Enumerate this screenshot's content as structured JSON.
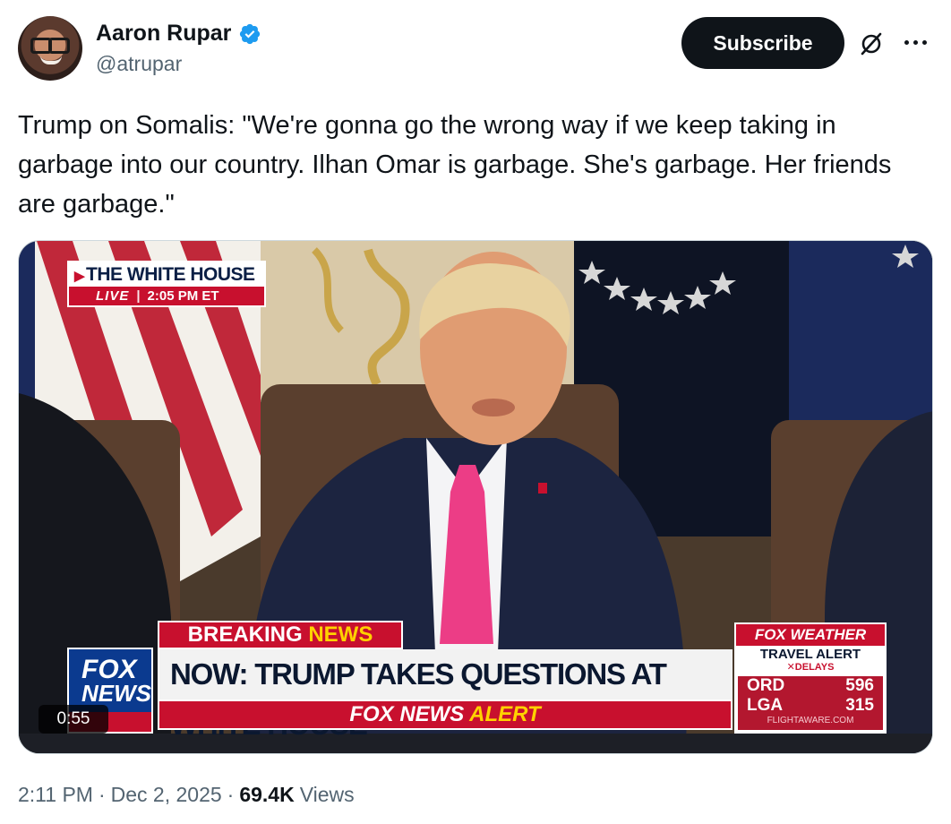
{
  "author": {
    "name": "Aaron Rupar",
    "handle": "@atrupar",
    "verified_icon": "verified-badge-icon",
    "verified_color": "#1d9bf0"
  },
  "actions": {
    "subscribe_label": "Subscribe",
    "grok_icon": "grok-icon",
    "more_icon": "more-options-icon"
  },
  "tweet": {
    "text": "Trump on Somalis: \"We're gonna go the wrong way if we keep taking in garbage into our country. Ilhan Omar is garbage. She's garbage. Her friends are garbage.\""
  },
  "video": {
    "duration": "0:55",
    "location_bug": {
      "title": "THE WHITE HOUSE",
      "live": "LIVE",
      "time": "2:05 PM ET"
    },
    "lower_third": {
      "breaking": "BREAKING",
      "news": "NEWS",
      "headline": "NOW: TRUMP TAKES QUESTIONS AT WHITE HOUSE",
      "alert_fox": "FOX NEWS",
      "alert_word": "ALERT"
    },
    "network_logo": {
      "line1": "FOX",
      "line2": "NEWS"
    },
    "weather": {
      "brand": "FOX WEATHER",
      "title": "TRAVEL ALERT",
      "subtitle": "DELAYS",
      "rows": [
        {
          "airport": "ORD",
          "value": "596"
        },
        {
          "airport": "LGA",
          "value": "315"
        }
      ],
      "source": "FLIGHTAWARE.COM"
    }
  },
  "meta": {
    "time": "2:11 PM",
    "date": "Dec 2, 2025",
    "views_count": "69.4K",
    "views_label": "Views"
  },
  "colors": {
    "text_primary": "#0f1419",
    "text_secondary": "#536471",
    "fox_red": "#c8102e",
    "fox_blue": "#0b3a8f",
    "alert_yellow": "#ffd200"
  }
}
